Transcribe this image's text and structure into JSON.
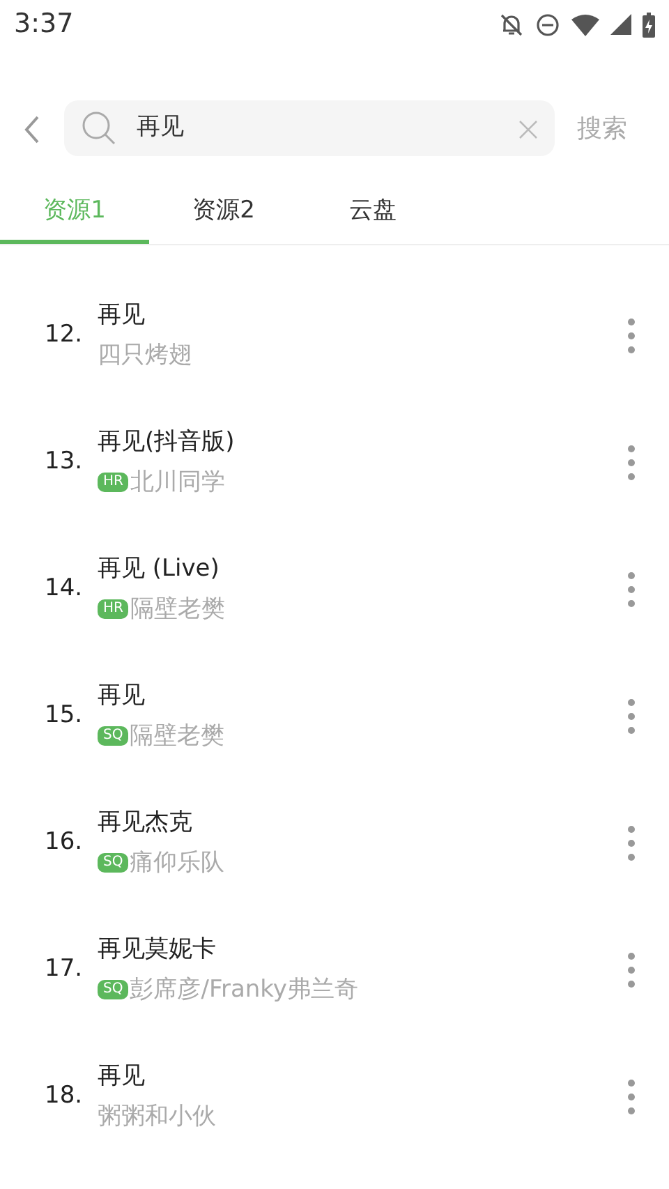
{
  "status_bar": {
    "time": "3:37"
  },
  "search": {
    "value": "再见",
    "action": "搜索"
  },
  "tabs": [
    {
      "label": "资源1",
      "selected": true
    },
    {
      "label": "资源2",
      "selected": false
    },
    {
      "label": "云盘",
      "selected": false
    }
  ],
  "songs": [
    {
      "index": "12.",
      "title": "再见",
      "artist": "四只烤翅"
    },
    {
      "index": "13.",
      "title": "再见(抖音版)",
      "tag": "HR",
      "artist": "北川同学"
    },
    {
      "index": "14.",
      "title": "再见 (Live)",
      "tag": "HR",
      "artist": "隔壁老樊"
    },
    {
      "index": "15.",
      "title": "再见",
      "tag": "SQ",
      "artist": "隔壁老樊"
    },
    {
      "index": "16.",
      "title": "再见杰克",
      "tag": "SQ",
      "artist": "痛仰乐队"
    },
    {
      "index": "17.",
      "title": "再见莫妮卡",
      "tag": "SQ",
      "artist": "彭席彦/Franky弗兰奇"
    },
    {
      "index": "18.",
      "title": "再见",
      "artist": "粥粥和小伙"
    }
  ]
}
